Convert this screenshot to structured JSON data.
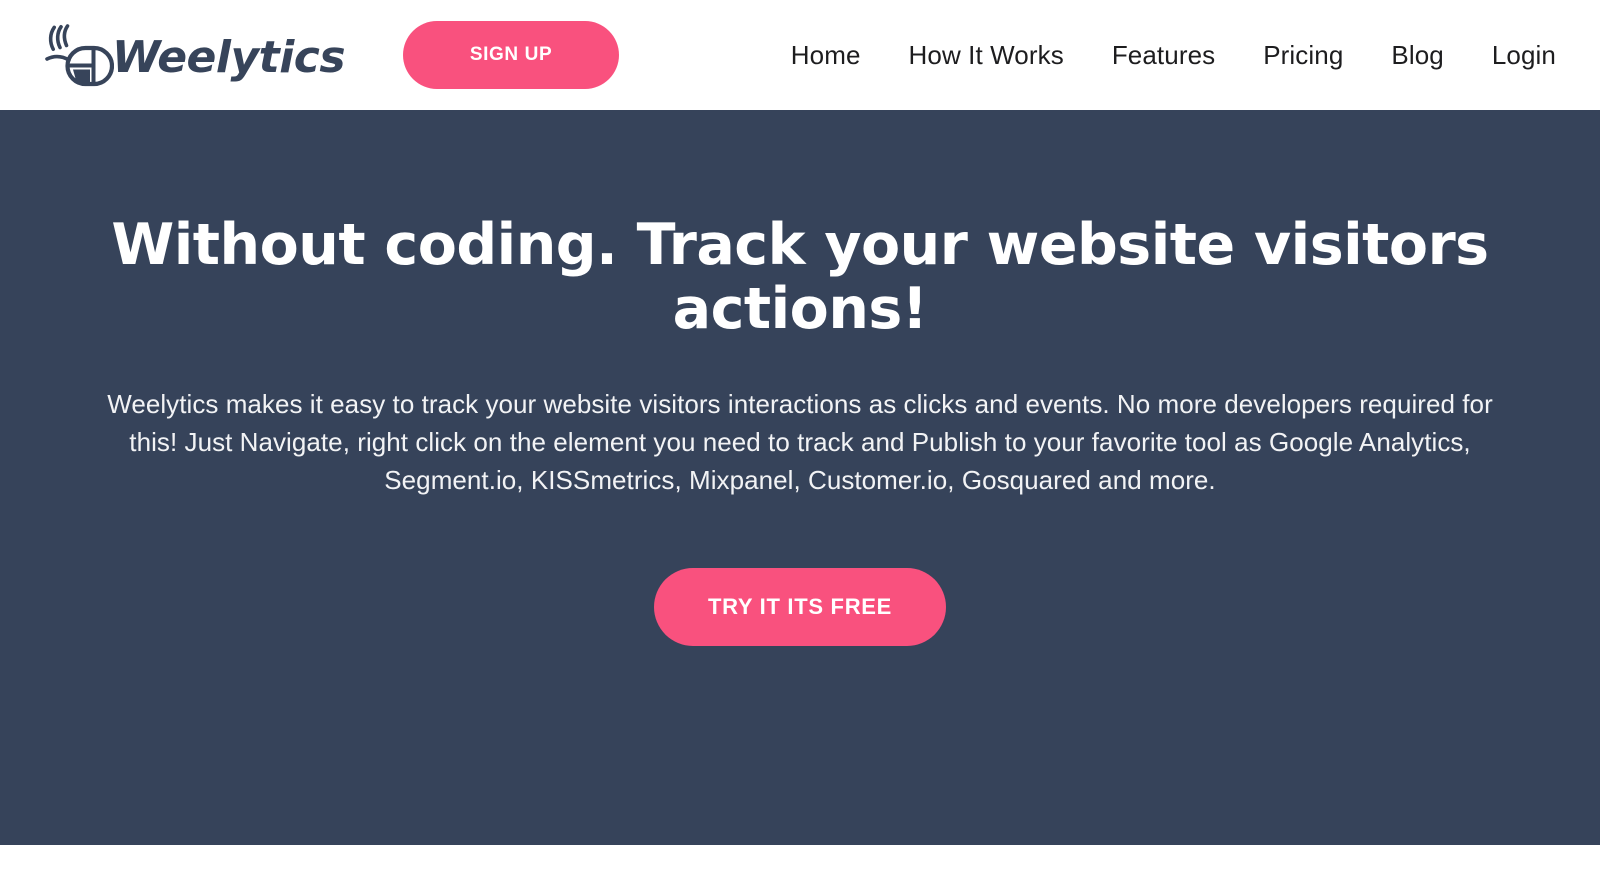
{
  "brand": {
    "name": "Weelytics",
    "logo_icon": "wireless-mouse-icon"
  },
  "header": {
    "signup_label": "SIGN UP",
    "nav": [
      {
        "label": "Home"
      },
      {
        "label": "How It Works"
      },
      {
        "label": "Features"
      },
      {
        "label": "Pricing"
      },
      {
        "label": "Blog"
      },
      {
        "label": "Login"
      }
    ]
  },
  "hero": {
    "title": "Without coding. Track your website visitors actions!",
    "subtitle_line_1": "Weelytics makes it easy to track your website visitors interactions as clicks and events. No more developers required for this!",
    "subtitle_line_2": "Just Navigate, right click on the element you need to track and Publish to your favorite tool as Google Analytics, Segment.io,",
    "subtitle_line_3": "KISSmetrics, Mixpanel, Customer.io, Gosquared and more.",
    "cta_label": "TRY IT ITS FREE"
  },
  "colors": {
    "accent_pink": "#F9517E",
    "hero_background": "#36435A",
    "brand_navy": "#37445A",
    "header_background": "#FFFFFF",
    "nav_text": "#1D1D1F",
    "hero_text": "#FFFFFF"
  }
}
